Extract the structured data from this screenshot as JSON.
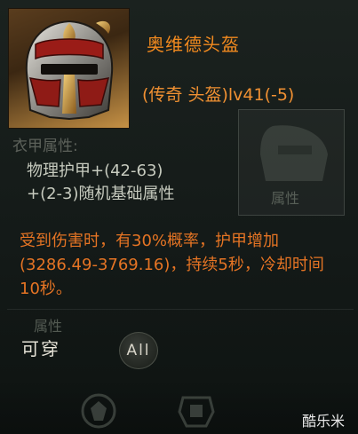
{
  "item": {
    "name": "奥维德头盔",
    "meta": "(传奇 头盔)lv41(-5)",
    "icon": "helmet-icon"
  },
  "attributes": {
    "faded_title": "衣甲属性:",
    "lines": [
      "物理护甲+(42-63)",
      "+(2-3)随机基础属性"
    ]
  },
  "ghost_slot": {
    "label": "属性"
  },
  "effect": {
    "part1": "受到伤害时，有",
    "percent": "30%",
    "part2": "概率，护甲增加",
    "value_range": "(3286.49-3769.16)",
    "part3": "，持续",
    "duration": "5",
    "part4": "秒，冷却时间",
    "cooldown": "10",
    "part5": "秒。"
  },
  "footer": {
    "faded_attr": "属性",
    "wearable": "可穿",
    "all_badge": "All"
  },
  "watermark": "酷乐米",
  "colors": {
    "name": "#f28a1f",
    "effect": "#e57424",
    "attr_text": "#c7cbbf",
    "frame_gold": "#c69145"
  }
}
